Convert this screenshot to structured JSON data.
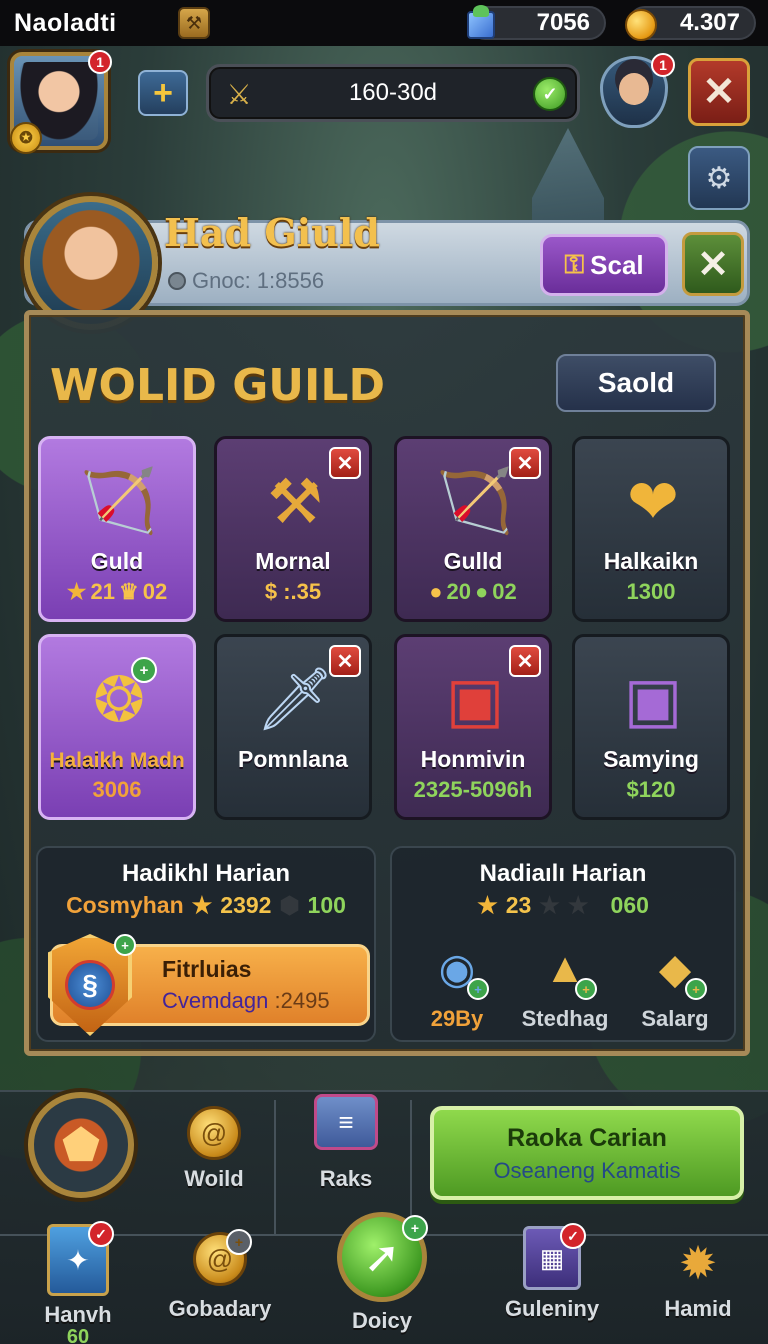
{
  "status_bar": {
    "app_title": "Naoladti",
    "gems": "7056",
    "gold": "4.307"
  },
  "header": {
    "player_badge": "1",
    "search_value": "160-30d",
    "friend_badge": "1"
  },
  "guild": {
    "name": "Had Giuld",
    "subtitle": "Gnoc: 1:8556",
    "scal_button": "Scal"
  },
  "panel": {
    "title": "WOLID GUILD",
    "saold_button": "Saold",
    "tiles": [
      {
        "name": "Guld",
        "stat_a": "21",
        "stat_b": "02",
        "icon": "crossbow-icon"
      },
      {
        "name": "Mornal",
        "stat_a": "$ :.35",
        "icon": "hammer-icon"
      },
      {
        "name": "Gulld",
        "stat_a": "20",
        "stat_b": "02",
        "icon": "crossbow-icon"
      },
      {
        "name": "Halkaikn",
        "stat_a": "1300",
        "icon": "heart-emblem-icon"
      },
      {
        "name": "Halaikh Madn",
        "stat_a": "3006",
        "icon": "ring-emblem-icon"
      },
      {
        "name": "Pomnlana",
        "icon": "dagger-icon"
      },
      {
        "name": "Honmivin",
        "stat_a": "2325-5096h",
        "icon": "chest-icon"
      },
      {
        "name": "Samying",
        "stat_a": "$120",
        "icon": "purple-chest-icon"
      }
    ]
  },
  "lower_left": {
    "title": "Hadikhl Harian",
    "label": "Cosmyhan",
    "stars_value": "2392",
    "green_value": "100",
    "card_title": "Fitrluias",
    "card_sub_label": "Cvemdagn",
    "card_sub_value": ":2495"
  },
  "lower_right": {
    "title": "Nadiaılı Harian",
    "stars_value": "23",
    "green_value": "060",
    "rewards": [
      {
        "label": "29By"
      },
      {
        "label": "Stedhag"
      },
      {
        "label": "Salarg"
      }
    ]
  },
  "nav": {
    "woild": "Woild",
    "raks": "Raks",
    "raka_title": "Raoka Carian",
    "raka_sub": "Oseaneng Kamatis",
    "hanvh": "Hanvh",
    "hanvh_sub": "60",
    "gobadary": "Gobadary",
    "doicy": "Doicy",
    "guleniny": "Guleniny",
    "hamid": "Hamid"
  },
  "colors": {
    "gold_text": "#f4c34b",
    "green_text": "#8fd45c",
    "purple_tile": "#9a57c9",
    "green_button": "#6fbf38"
  }
}
